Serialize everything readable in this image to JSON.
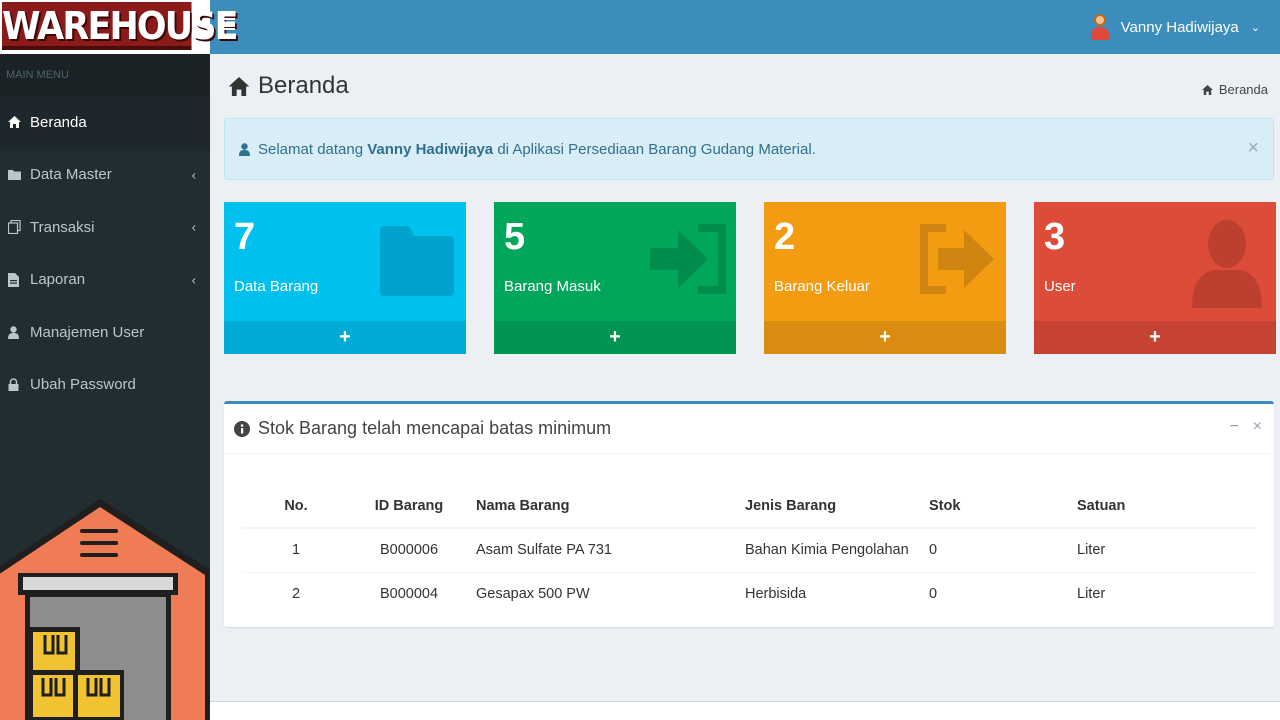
{
  "header": {
    "logo_text": "WAREHOUSE",
    "user_name": "Vanny Hadiwijaya",
    "menu_icon": "hamburger-icon"
  },
  "sidebar": {
    "section_title": "MAIN MENU",
    "items": [
      {
        "label": "Beranda",
        "icon": "home-icon",
        "active": true
      },
      {
        "label": "Data Master",
        "icon": "folder-icon",
        "has_children": true
      },
      {
        "label": "Transaksi",
        "icon": "copy-icon",
        "has_children": true
      },
      {
        "label": "Laporan",
        "icon": "file-icon",
        "has_children": true
      },
      {
        "label": "Manajemen User",
        "icon": "user-icon"
      },
      {
        "label": "Ubah Password",
        "icon": "lock-icon"
      }
    ]
  },
  "page": {
    "title": "Beranda",
    "breadcrumb": "Beranda"
  },
  "alert": {
    "prefix": "Selamat datang",
    "user": "Vanny Hadiwijaya",
    "suffix": "di Aplikasi Persediaan Barang Gudang Material.",
    "close": "×"
  },
  "stats": [
    {
      "value": "7",
      "label": "Data Barang",
      "color": "#00c0ef",
      "icon": "folder-icon"
    },
    {
      "value": "5",
      "label": "Barang Masuk",
      "color": "#00a65a",
      "icon": "sign-in-icon"
    },
    {
      "value": "2",
      "label": "Barang Keluar",
      "color": "#f39c12",
      "icon": "sign-out-icon"
    },
    {
      "value": "3",
      "label": "User",
      "color": "#dd4b39",
      "icon": "user-icon"
    }
  ],
  "stat_footer": "+",
  "stock_panel": {
    "title": "Stok Barang telah mencapai batas minimum",
    "minimize": "−",
    "close": "×",
    "columns": [
      "No.",
      "ID Barang",
      "Nama Barang",
      "Jenis Barang",
      "Stok",
      "Satuan"
    ],
    "rows": [
      [
        "1",
        "B000006",
        "Asam Sulfate PA 731",
        "Bahan Kimia Pengolahan",
        "0",
        "Liter"
      ],
      [
        "2",
        "B000004",
        "Gesapax 500 PW",
        "Herbisida",
        "0",
        "Liter"
      ]
    ]
  }
}
